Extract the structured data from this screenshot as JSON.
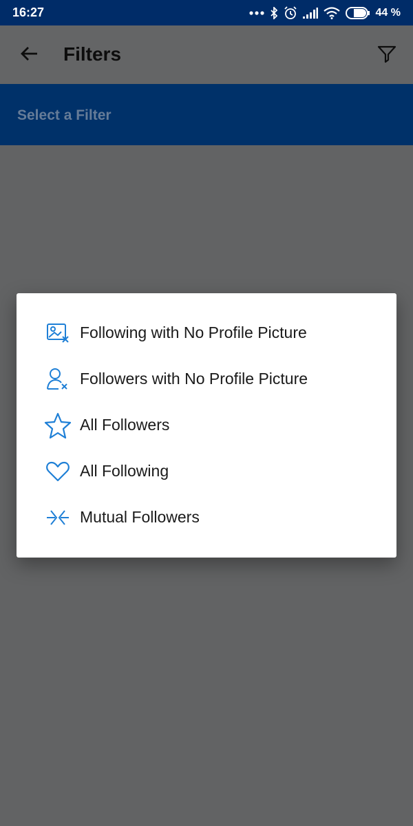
{
  "status_bar": {
    "time": "16:27",
    "battery": "44 %"
  },
  "app_bar": {
    "title": "Filters"
  },
  "subheader": {
    "label": "Select a Filter"
  },
  "dialog": {
    "options": [
      {
        "label": "Following with No Profile Picture",
        "icon": "image-x-icon"
      },
      {
        "label": "Followers with No Profile Picture",
        "icon": "user-x-icon"
      },
      {
        "label": "All Followers",
        "icon": "star-icon"
      },
      {
        "label": "All Following",
        "icon": "heart-icon"
      },
      {
        "label": "Mutual Followers",
        "icon": "mutual-arrows-icon"
      }
    ]
  },
  "colors": {
    "status_bar": "#002c68",
    "header_band": "#003169",
    "overlay": "#626364",
    "icon_blue": "#1e7fd6"
  }
}
